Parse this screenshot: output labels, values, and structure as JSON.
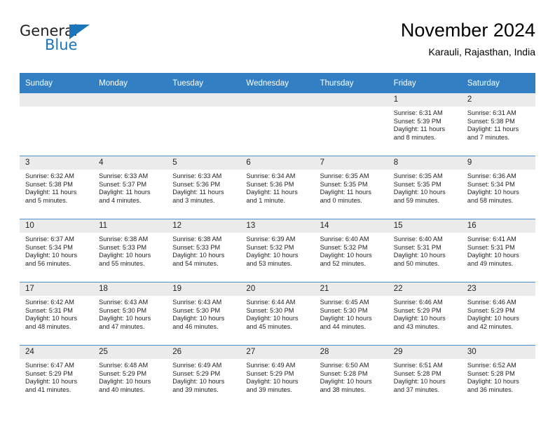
{
  "brand": {
    "general": "General",
    "blue": "Blue",
    "icon": "triangle-logo-icon"
  },
  "header": {
    "title": "November 2024",
    "subtitle": "Karauli, Rajasthan, India"
  },
  "colors": {
    "header_blue": "#3280c3",
    "brand_blue": "#1b75bb",
    "daynum_band": "#ebebeb",
    "text": "#231f20"
  },
  "calendar": {
    "weekdays": [
      "Sunday",
      "Monday",
      "Tuesday",
      "Wednesday",
      "Thursday",
      "Friday",
      "Saturday"
    ],
    "labels": {
      "sunrise": "Sunrise:",
      "sunset": "Sunset:",
      "daylight": "Daylight:"
    },
    "weeks": [
      [
        {
          "day": "",
          "blank": true
        },
        {
          "day": "",
          "blank": true
        },
        {
          "day": "",
          "blank": true
        },
        {
          "day": "",
          "blank": true
        },
        {
          "day": "",
          "blank": true
        },
        {
          "day": "1",
          "sunrise": "Sunrise: 6:31 AM",
          "sunset": "Sunset: 5:39 PM",
          "daylight": "Daylight: 11 hours and 8 minutes."
        },
        {
          "day": "2",
          "sunrise": "Sunrise: 6:31 AM",
          "sunset": "Sunset: 5:38 PM",
          "daylight": "Daylight: 11 hours and 7 minutes."
        }
      ],
      [
        {
          "day": "3",
          "sunrise": "Sunrise: 6:32 AM",
          "sunset": "Sunset: 5:38 PM",
          "daylight": "Daylight: 11 hours and 5 minutes."
        },
        {
          "day": "4",
          "sunrise": "Sunrise: 6:33 AM",
          "sunset": "Sunset: 5:37 PM",
          "daylight": "Daylight: 11 hours and 4 minutes."
        },
        {
          "day": "5",
          "sunrise": "Sunrise: 6:33 AM",
          "sunset": "Sunset: 5:36 PM",
          "daylight": "Daylight: 11 hours and 3 minutes."
        },
        {
          "day": "6",
          "sunrise": "Sunrise: 6:34 AM",
          "sunset": "Sunset: 5:36 PM",
          "daylight": "Daylight: 11 hours and 1 minute."
        },
        {
          "day": "7",
          "sunrise": "Sunrise: 6:35 AM",
          "sunset": "Sunset: 5:35 PM",
          "daylight": "Daylight: 11 hours and 0 minutes."
        },
        {
          "day": "8",
          "sunrise": "Sunrise: 6:35 AM",
          "sunset": "Sunset: 5:35 PM",
          "daylight": "Daylight: 10 hours and 59 minutes."
        },
        {
          "day": "9",
          "sunrise": "Sunrise: 6:36 AM",
          "sunset": "Sunset: 5:34 PM",
          "daylight": "Daylight: 10 hours and 58 minutes."
        }
      ],
      [
        {
          "day": "10",
          "sunrise": "Sunrise: 6:37 AM",
          "sunset": "Sunset: 5:34 PM",
          "daylight": "Daylight: 10 hours and 56 minutes."
        },
        {
          "day": "11",
          "sunrise": "Sunrise: 6:38 AM",
          "sunset": "Sunset: 5:33 PM",
          "daylight": "Daylight: 10 hours and 55 minutes."
        },
        {
          "day": "12",
          "sunrise": "Sunrise: 6:38 AM",
          "sunset": "Sunset: 5:33 PM",
          "daylight": "Daylight: 10 hours and 54 minutes."
        },
        {
          "day": "13",
          "sunrise": "Sunrise: 6:39 AM",
          "sunset": "Sunset: 5:32 PM",
          "daylight": "Daylight: 10 hours and 53 minutes."
        },
        {
          "day": "14",
          "sunrise": "Sunrise: 6:40 AM",
          "sunset": "Sunset: 5:32 PM",
          "daylight": "Daylight: 10 hours and 52 minutes."
        },
        {
          "day": "15",
          "sunrise": "Sunrise: 6:40 AM",
          "sunset": "Sunset: 5:31 PM",
          "daylight": "Daylight: 10 hours and 50 minutes."
        },
        {
          "day": "16",
          "sunrise": "Sunrise: 6:41 AM",
          "sunset": "Sunset: 5:31 PM",
          "daylight": "Daylight: 10 hours and 49 minutes."
        }
      ],
      [
        {
          "day": "17",
          "sunrise": "Sunrise: 6:42 AM",
          "sunset": "Sunset: 5:31 PM",
          "daylight": "Daylight: 10 hours and 48 minutes."
        },
        {
          "day": "18",
          "sunrise": "Sunrise: 6:43 AM",
          "sunset": "Sunset: 5:30 PM",
          "daylight": "Daylight: 10 hours and 47 minutes."
        },
        {
          "day": "19",
          "sunrise": "Sunrise: 6:43 AM",
          "sunset": "Sunset: 5:30 PM",
          "daylight": "Daylight: 10 hours and 46 minutes."
        },
        {
          "day": "20",
          "sunrise": "Sunrise: 6:44 AM",
          "sunset": "Sunset: 5:30 PM",
          "daylight": "Daylight: 10 hours and 45 minutes."
        },
        {
          "day": "21",
          "sunrise": "Sunrise: 6:45 AM",
          "sunset": "Sunset: 5:30 PM",
          "daylight": "Daylight: 10 hours and 44 minutes."
        },
        {
          "day": "22",
          "sunrise": "Sunrise: 6:46 AM",
          "sunset": "Sunset: 5:29 PM",
          "daylight": "Daylight: 10 hours and 43 minutes."
        },
        {
          "day": "23",
          "sunrise": "Sunrise: 6:46 AM",
          "sunset": "Sunset: 5:29 PM",
          "daylight": "Daylight: 10 hours and 42 minutes."
        }
      ],
      [
        {
          "day": "24",
          "sunrise": "Sunrise: 6:47 AM",
          "sunset": "Sunset: 5:29 PM",
          "daylight": "Daylight: 10 hours and 41 minutes."
        },
        {
          "day": "25",
          "sunrise": "Sunrise: 6:48 AM",
          "sunset": "Sunset: 5:29 PM",
          "daylight": "Daylight: 10 hours and 40 minutes."
        },
        {
          "day": "26",
          "sunrise": "Sunrise: 6:49 AM",
          "sunset": "Sunset: 5:29 PM",
          "daylight": "Daylight: 10 hours and 39 minutes."
        },
        {
          "day": "27",
          "sunrise": "Sunrise: 6:49 AM",
          "sunset": "Sunset: 5:29 PM",
          "daylight": "Daylight: 10 hours and 39 minutes."
        },
        {
          "day": "28",
          "sunrise": "Sunrise: 6:50 AM",
          "sunset": "Sunset: 5:28 PM",
          "daylight": "Daylight: 10 hours and 38 minutes."
        },
        {
          "day": "29",
          "sunrise": "Sunrise: 6:51 AM",
          "sunset": "Sunset: 5:28 PM",
          "daylight": "Daylight: 10 hours and 37 minutes."
        },
        {
          "day": "30",
          "sunrise": "Sunrise: 6:52 AM",
          "sunset": "Sunset: 5:28 PM",
          "daylight": "Daylight: 10 hours and 36 minutes."
        }
      ]
    ]
  }
}
